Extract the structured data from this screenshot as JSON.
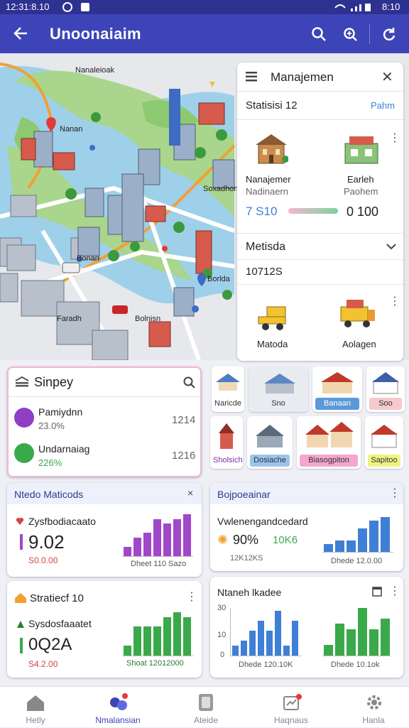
{
  "status_bar": {
    "time": "12:31:8.10",
    "right": "8:10"
  },
  "app_bar": {
    "title": "Unoonaiaim"
  },
  "map": {
    "labels": [
      {
        "text": "Nanaleioak"
      },
      {
        "text": "Nanan"
      },
      {
        "text": "Soxadhonas"
      },
      {
        "text": "Bonan"
      },
      {
        "text": "Borlda"
      },
      {
        "text": "Faradh"
      },
      {
        "text": "Bolnisn"
      }
    ]
  },
  "panel": {
    "title": "Manajemen",
    "stats_label": "Statisisi 12",
    "stats_action": "Pahm",
    "item1_name": "Nanajemer",
    "item1_sub": "Nadinaern",
    "item2_name": "Earleh",
    "item2_sub": "Paohem",
    "value_left": "7 S10",
    "value_right": "0 100",
    "dropdown_label": "Metisda",
    "dropdown_value": "10712S",
    "item3_name": "Matoda",
    "item4_name": "Aolagen"
  },
  "search_card": {
    "title": "Sinpey",
    "rows": [
      {
        "name": "Pamiydnn",
        "percent": "23.0%",
        "value": "1214",
        "color": "#8e3fc5"
      },
      {
        "name": "Undarnaiag",
        "percent": "226%",
        "value": "1216",
        "color": "#3aa94a"
      }
    ]
  },
  "tiles": [
    {
      "label": "Naricde",
      "bg": "#ffffff",
      "fg": "#333"
    },
    {
      "label": "Sno",
      "bg": "#e8ecf0",
      "fg": "#333"
    },
    {
      "label": "Banaan",
      "bg": "#5b9ad9",
      "fg": "#fff"
    },
    {
      "label": "Soo",
      "bg": "#f6c9cc",
      "fg": "#333"
    },
    {
      "label": "Sholsicho",
      "bg": "#ffffff",
      "fg": "#7a2aa8"
    },
    {
      "label": "Dosiache",
      "bg": "#9fc4ea",
      "fg": "#234"
    },
    {
      "label": "Biasogpiton",
      "bg": "#f4a7cc",
      "fg": "#333"
    },
    {
      "label": "Sapitoo",
      "bg": "#eef580",
      "fg": "#333"
    }
  ],
  "stat_cards": [
    {
      "header": "Ntedo Maticods",
      "close": "×",
      "title": "Zysfbodiacaato",
      "value": "9.02",
      "delta": "S0.0.00",
      "footer": "Dheet 110 Sazo",
      "color": "#a048c8"
    },
    {
      "header": "Bojpoeainar",
      "title": "Vwlenengandcedard",
      "value": "90%",
      "value2": "10K6",
      "delta": "12K12KS",
      "footer": "Dhede 12.0.00",
      "color": "#3f7fd6"
    },
    {
      "header": "Stratiecf 10",
      "title": "Sysdosfaaatet",
      "value": "0Q2A",
      "delta": "S4.2.00",
      "footer": "Shoat 12012000",
      "color": "#3aa94a"
    },
    {
      "header": "Ntaneh lkadee",
      "footer": "Dhede 120.10K",
      "footer2": "Dhede 10.1ok",
      "color": "#3f7fd6"
    }
  ],
  "chart_data": [
    {
      "type": "bar",
      "values": [
        2,
        4,
        5,
        8,
        7,
        8,
        9
      ],
      "color": "#a048c8"
    },
    {
      "type": "bar",
      "values": [
        2,
        3,
        3,
        6,
        8,
        9
      ],
      "color": "#3f7fd6"
    },
    {
      "type": "bar",
      "values": [
        2,
        6,
        6,
        6,
        8,
        9,
        8
      ],
      "color": "#3aa94a"
    },
    {
      "type": "bar",
      "yticks": [
        "30",
        "10",
        "0"
      ],
      "values": [
        2,
        3,
        5,
        7,
        5,
        9,
        2,
        7
      ],
      "color": "#3f7fd6"
    },
    {
      "type": "bar",
      "values": [
        2,
        6,
        5,
        9,
        5,
        7
      ],
      "color": "#3aa94a"
    }
  ],
  "nav": [
    {
      "label": "Hetly",
      "active": false
    },
    {
      "label": "Nmalansian",
      "active": true
    },
    {
      "label": "Ateide",
      "active": false
    },
    {
      "label": "Haqnaus",
      "active": false
    },
    {
      "label": "Hanla",
      "active": false
    }
  ],
  "colors": {
    "primary": "#3d44b7",
    "status": "#2d3190",
    "purple": "#8e3fc5",
    "green": "#3aa94a",
    "blue": "#3f7fd6",
    "red": "#d64545"
  }
}
